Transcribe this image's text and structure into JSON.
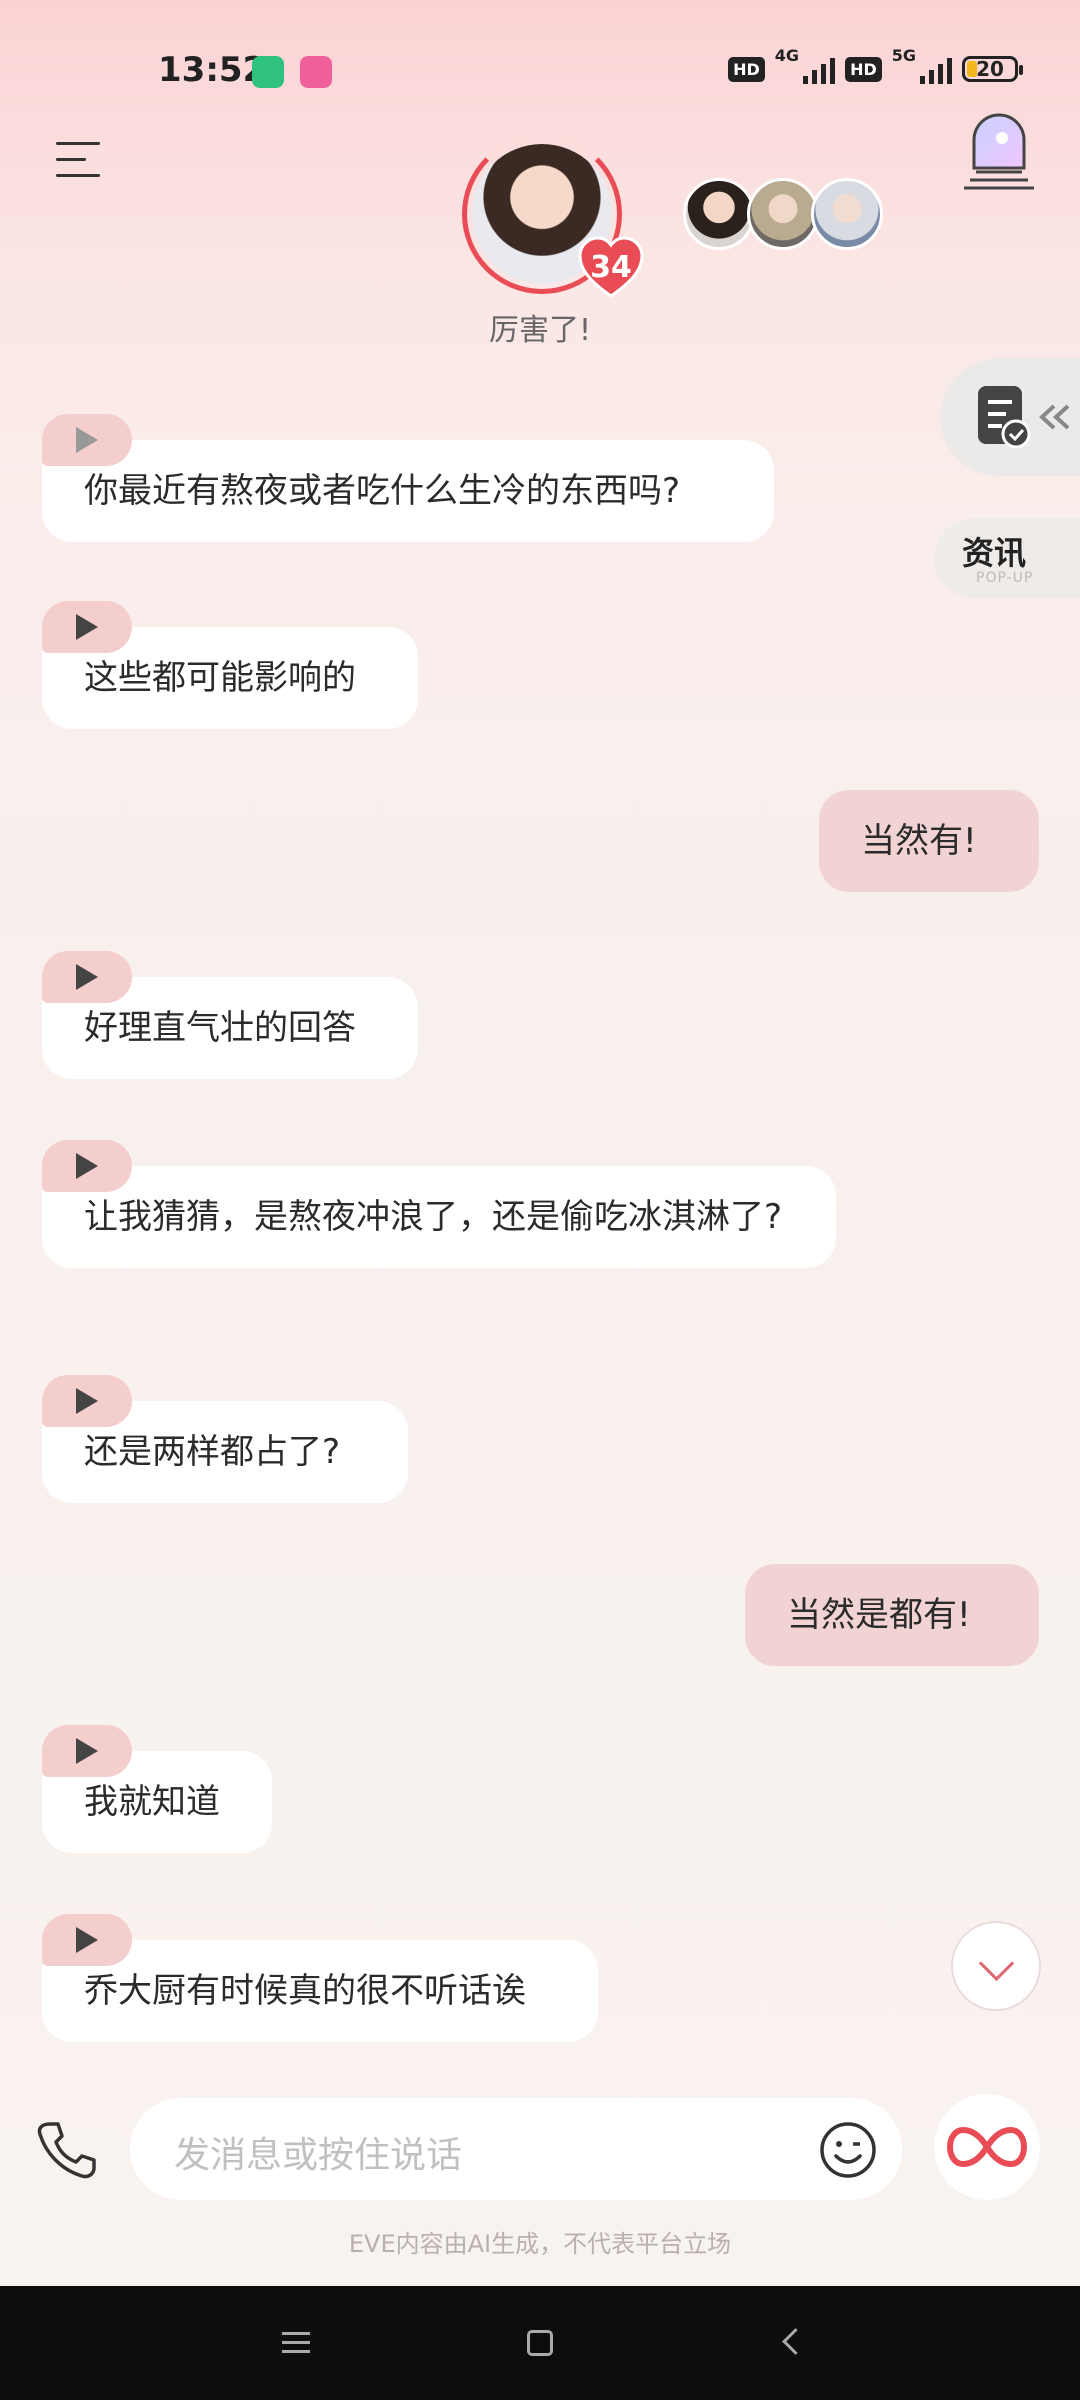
{
  "status_bar": {
    "time": "13:52",
    "net1": "4G",
    "net2": "5G",
    "hd": "HD",
    "battery": "20"
  },
  "header": {
    "menu_icon": "menu-icon",
    "avatar_level": "34",
    "status_caption": "厉害了!",
    "scene_icon": "window-stairs-icon"
  },
  "side": {
    "doc_icon": "document-check-icon",
    "news_title": "资讯",
    "news_sub": "POP-UP"
  },
  "messages": [
    {
      "role": "ai",
      "text": "你最近有熬夜或者吃什么生冷的东西吗?"
    },
    {
      "role": "ai",
      "text": "这些都可能影响的"
    },
    {
      "role": "user",
      "text": "当然有!"
    },
    {
      "role": "ai",
      "text": "好理直气壮的回答"
    },
    {
      "role": "ai",
      "text": "让我猜猜，是熬夜冲浪了，还是偷吃冰淇淋了?"
    },
    {
      "role": "ai",
      "text": "还是两样都占了?"
    },
    {
      "role": "user",
      "text": "当然是都有!"
    },
    {
      "role": "ai",
      "text": "我就知道"
    },
    {
      "role": "ai",
      "text": "乔大厨有时候真的很不听话诶"
    }
  ],
  "input": {
    "placeholder": "发消息或按住说话"
  },
  "disclaimer": "EVE内容由AI生成，不代表平台立场",
  "colors": {
    "accent": "#e94c55",
    "user_bubble": "#f2d3d3",
    "ai_bubble": "#ffffff",
    "play_tag": "#f4cdcd"
  }
}
